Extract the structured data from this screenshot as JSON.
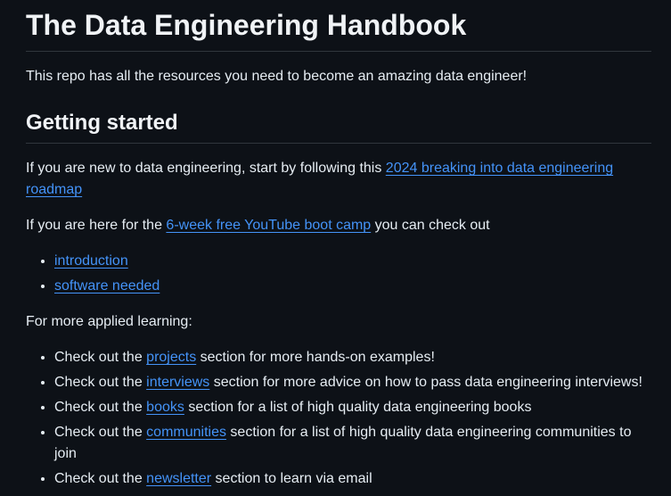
{
  "title": "The Data Engineering Handbook",
  "intro": "This repo has all the resources you need to become an amazing data engineer!",
  "getting_started": {
    "heading": "Getting started",
    "roadmap": {
      "prefix": "If you are new to data engineering, start by following this ",
      "link": "2024 breaking into data engineering roadmap"
    },
    "bootcamp": {
      "prefix": "If you are here for the ",
      "link": "6-week free YouTube boot camp",
      "suffix": " you can check out"
    },
    "bootcamp_links": [
      {
        "label": "introduction"
      },
      {
        "label": "software needed"
      }
    ],
    "applied_label": "For more applied learning:",
    "applied_items": [
      {
        "prefix": "Check out the ",
        "link": "projects",
        "suffix": " section for more hands-on examples!"
      },
      {
        "prefix": "Check out the ",
        "link": "interviews",
        "suffix": " section for more advice on how to pass data engineering interviews!"
      },
      {
        "prefix": "Check out the ",
        "link": "books",
        "suffix": " section for a list of high quality data engineering books"
      },
      {
        "prefix": "Check out the ",
        "link": "communities",
        "suffix": " section for a list of high quality data engineering communities to join"
      },
      {
        "prefix": "Check out the ",
        "link": "newsletter",
        "suffix": " section to learn via email"
      }
    ]
  },
  "colors": {
    "background": "#0d1117",
    "text": "#e6edf3",
    "link": "#4493f8",
    "divider": "#30363d"
  }
}
